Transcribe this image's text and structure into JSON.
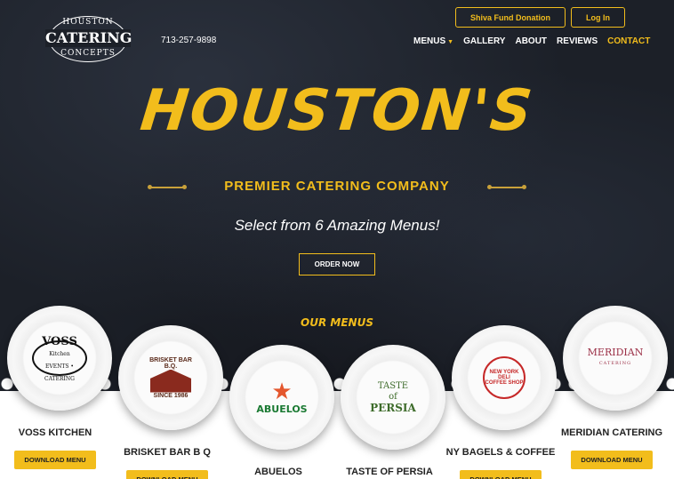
{
  "header": {
    "logo": {
      "line1": "HOUSTON",
      "line2": "CATERING",
      "line3": "CONCEPTS"
    },
    "phone": "713-257-9898",
    "buttons": {
      "donation": "Shiva Fund Donation",
      "login": "Log In"
    },
    "nav": [
      {
        "label": "MENUS",
        "has_dropdown": true
      },
      {
        "label": "GALLERY"
      },
      {
        "label": "ABOUT"
      },
      {
        "label": "REVIEWS"
      },
      {
        "label": "CONTACT",
        "active": true
      }
    ]
  },
  "hero": {
    "headline": "HOUSTON'S",
    "subtitle": "PREMIER CATERING COMPANY",
    "tagline": "Select from 6 Amazing Menus!",
    "cta": "ORDER NOW"
  },
  "menus_section": {
    "heading": "OUR MENUS",
    "download_label": "DOWNLOAD MENU",
    "cards": [
      {
        "name": "VOSS KITCHEN",
        "logo_text": "VOSS",
        "logo_sub": "Kitchen",
        "logo_small": "EVENTS • CATERING"
      },
      {
        "name": "BRISKET BAR B Q",
        "logo_text": "BRISKET BAR B.Q.",
        "logo_sub": "SINCE 1986"
      },
      {
        "name": "ABUELOS",
        "logo_text": "ABUELOS"
      },
      {
        "name": "TASTE OF PERSIA",
        "logo_text": "TASTE",
        "logo_mid": "of",
        "logo_sub": "PERSIA"
      },
      {
        "name": "NY BAGELS & COFFEE",
        "logo_text": "NEW YORK DELI",
        "logo_sub": "COFFEE SHOP"
      },
      {
        "name": "MERIDIAN CATERING",
        "logo_text": "MERIDIAN",
        "logo_sub": "CATERING"
      }
    ]
  },
  "colors": {
    "accent": "#f2bd1c",
    "background": "#1c2028"
  }
}
